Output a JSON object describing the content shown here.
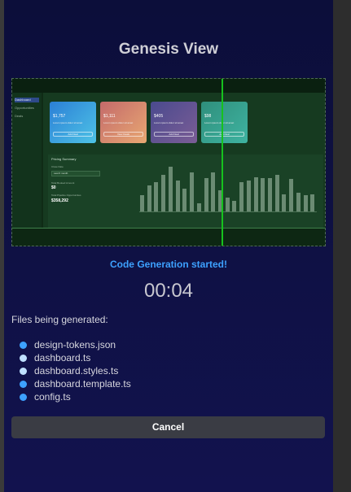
{
  "dialog": {
    "title": "Genesis View",
    "status": "Code Generation started!",
    "timer": "00:04",
    "files_heading": "Files being generated:",
    "files": [
      {
        "name": "design-tokens.json",
        "dot_color": "#3da1ff"
      },
      {
        "name": "dashboard.ts",
        "dot_color": "#bfe0ff"
      },
      {
        "name": "dashboard.styles.ts",
        "dot_color": "#bfe0ff"
      },
      {
        "name": "dashboard.template.ts",
        "dot_color": "#3da1ff"
      },
      {
        "name": "config.ts",
        "dot_color": "#3da1ff"
      }
    ],
    "cancel_label": "Cancel"
  },
  "preview": {
    "sidebar": [
      "Dashboard",
      "Opportunities",
      "Deals"
    ],
    "cards": [
      {
        "amount": "$1,757",
        "sub": "Lorem ipsum dolor sit amet",
        "button": "Add Deal",
        "gradient": [
          "#2b7fd6",
          "#4ec3e6"
        ]
      },
      {
        "amount": "$1,111",
        "sub": "Lorem ipsum dolor sit amet",
        "button": "View Deals",
        "gradient": [
          "#c46a6a",
          "#e8a873"
        ]
      },
      {
        "amount": "$405",
        "sub": "Lorem ipsum dolor sit amet",
        "button": "Add Deal",
        "gradient": [
          "#4a4a8e",
          "#7b5d96"
        ]
      },
      {
        "amount": "$98",
        "sub": "Lorem ipsum dolor sit amet",
        "button": "Add Deal",
        "gradient": [
          "#2f8f7c",
          "#3fb3a1"
        ]
      }
    ],
    "chart_panel": {
      "title": "Pricing Summary",
      "select_label": "Close Date",
      "select_value": "Last 6 month",
      "stat1_label": "Total Booked Amount",
      "stat1_value": "$0",
      "stat2_label": "Total Pipeline Opportunities",
      "stat2_value": "$358,292"
    },
    "bar_levels": [
      0.35,
      0.55,
      0.62,
      0.78,
      0.95,
      0.66,
      0.49,
      0.82,
      0.18,
      0.7,
      0.83,
      0.45,
      0.3,
      0.22,
      0.63,
      0.66,
      0.72,
      0.7,
      0.7,
      0.77,
      0.37,
      0.69,
      0.4,
      0.35,
      0.36
    ]
  }
}
